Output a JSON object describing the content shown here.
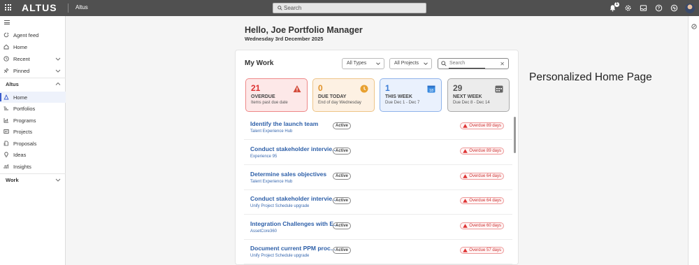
{
  "topbar": {
    "logo": "ALTUS",
    "workspace": "Altus",
    "search_placeholder": "Search",
    "notification_count": "1",
    "icons": [
      "apps-grid-icon",
      "bell-icon",
      "gear-icon",
      "inbox-icon",
      "help-icon",
      "pulse-icon",
      "avatar"
    ]
  },
  "sidebar": {
    "top_items": [
      {
        "label": "Agent feed",
        "icon": "agent-feed-icon"
      },
      {
        "label": "Home",
        "icon": "home-icon"
      },
      {
        "label": "Recent",
        "icon": "clock-icon"
      },
      {
        "label": "Pinned",
        "icon": "pin-icon"
      }
    ],
    "section_altus": "Altus",
    "altus_items": [
      {
        "label": "Home",
        "icon": "altus-home-icon"
      },
      {
        "label": "Portfolios",
        "icon": "portfolio-icon"
      },
      {
        "label": "Programs",
        "icon": "program-icon"
      },
      {
        "label": "Projects",
        "icon": "project-icon"
      },
      {
        "label": "Proposals",
        "icon": "proposal-icon"
      },
      {
        "label": "Ideas",
        "icon": "lightbulb-icon"
      },
      {
        "label": "Insights",
        "icon": "insights-icon"
      }
    ],
    "section_work": "Work"
  },
  "greeting": "Hello, Joe Portfolio Manager",
  "date": "Wednesday 3rd December 2025",
  "caption": "Personalized Home Page",
  "mywork": {
    "title": "My Work",
    "type_filter": "All Types",
    "project_filter": "All Projects",
    "search_placeholder": "Search",
    "tiles": [
      {
        "count": "21",
        "label": "OVERDUE",
        "sub": "Items past due date",
        "color": "#d33"
      },
      {
        "count": "0",
        "label": "DUE TODAY",
        "sub": "End of day Wednesday",
        "color": "#e0922a"
      },
      {
        "count": "1",
        "label": "THIS WEEK",
        "sub": "Due Dec 1 - Dec 7",
        "color": "#3a7bd5",
        "cal": "18"
      },
      {
        "count": "29",
        "label": "NEXT WEEK",
        "sub": "Due Dec 8 - Dec 14",
        "color": "#555"
      }
    ],
    "items": [
      {
        "title": "Identify the launch team",
        "project": "Talent Experience Hub",
        "status": "Active",
        "overdue": "Overdue 89 days"
      },
      {
        "title": "Conduct stakeholder intervie...",
        "project": "Experience 95",
        "status": "Active",
        "overdue": "Overdue 89 days"
      },
      {
        "title": "Determine sales objectives",
        "project": "Talent Experience Hub",
        "status": "Active",
        "overdue": "Overdue 64 days"
      },
      {
        "title": "Conduct stakeholder intervie...",
        "project": "Unify Project Schedule upgrade",
        "status": "Active",
        "overdue": "Overdue 64 days"
      },
      {
        "title": "Integration Challenges with E...",
        "project": "AssetCore360",
        "status": "Active",
        "overdue": "Overdue 60 days"
      },
      {
        "title": "Document current PPM proc...",
        "project": "Unify Project Schedule upgrade",
        "status": "Active",
        "overdue": "Overdue 57 days"
      }
    ]
  }
}
